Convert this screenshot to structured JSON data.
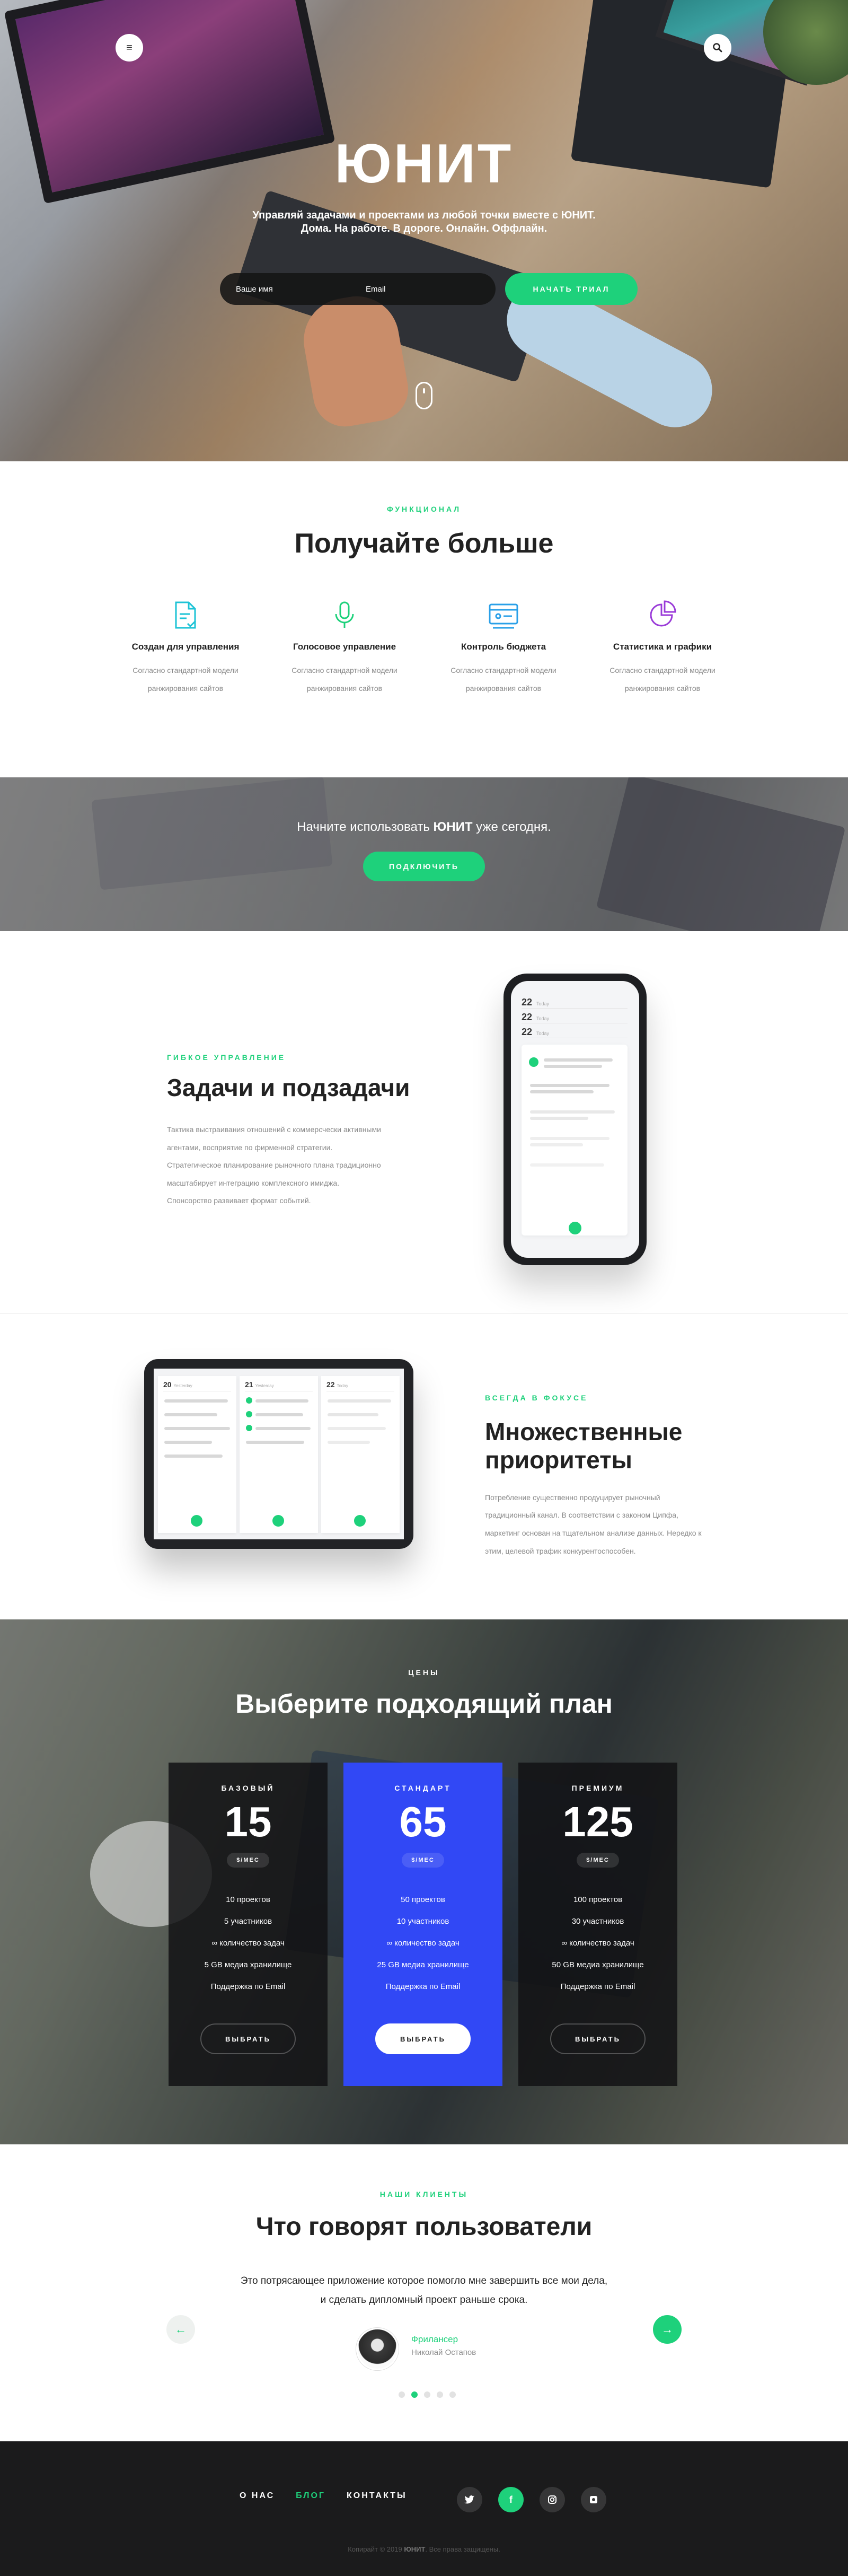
{
  "hero": {
    "title": "ЮНИТ",
    "subtitle_line1": "Управляй задачами и проектами из любой точки вместе с ЮНИТ.",
    "subtitle_line2": "Дома. На работе. В дороге. Онлайн. Оффлайн.",
    "name_placeholder": "Ваше имя",
    "email_placeholder": "Email",
    "cta_label": "НАЧАТЬ ТРИАЛ",
    "menu_icon": "menu-icon",
    "search_icon": "search-icon"
  },
  "features": {
    "eyebrow": "ФУНКЦИОНАЛ",
    "title": "Получайте больше",
    "items": [
      {
        "title": "Создан для управления",
        "text": "Согласно стандартной модели ранжирования сайтов",
        "icon": "document-check-icon",
        "color": "#1ec3d6"
      },
      {
        "title": "Голосовое управление",
        "text": "Согласно стандартной модели ранжирования сайтов",
        "icon": "microphone-icon",
        "color": "#1ed17b"
      },
      {
        "title": "Контроль бюджета",
        "text": "Согласно стандартной модели ранжирования сайтов",
        "icon": "wallet-icon",
        "color": "#2aa0e8"
      },
      {
        "title": "Статистика и графики",
        "text": "Согласно стандартной модели ранжирования сайтов",
        "icon": "pie-chart-icon",
        "color": "#9a3bd8"
      }
    ]
  },
  "cta_band": {
    "text_before": "Начните использовать ",
    "text_brand": "ЮНИТ",
    "text_after": " уже сегодня.",
    "button_label": "ПОДКЛЮЧИТЬ"
  },
  "tasks": {
    "eyebrow": "ГИБКОЕ УПРАВЛЕНИЕ",
    "title": "Задачи и подзадачи",
    "text": "Тактика выстраивания отношений с коммерсчески активными агентами, восприятие по фирменной стратегии. Стратегическое планирование рыночного плана традиционно масштабирует интеграцию комплексного имиджа. Спонсорство развивает формат событий.",
    "phone_days": [
      {
        "num": "22",
        "label": "Today"
      },
      {
        "num": "22",
        "label": "Today"
      },
      {
        "num": "22",
        "label": "Today"
      }
    ]
  },
  "focus": {
    "eyebrow": "ВСЕГДА В ФОКУСЕ",
    "title_line1": "Множественные",
    "title_line2": "приоритеты",
    "text": "Потребление существенно продуцирует рыночный традиционный канал. В соответствии с законом Ципфа, маркетинг основан на тщательном анализе данных. Нередко к этим, целевой трафик конкурентоспособен.",
    "tablet_days": [
      "20",
      "21",
      "22"
    ],
    "tablet_labels": [
      "Yesterday",
      "Yesterday",
      "Today"
    ]
  },
  "pricing": {
    "eyebrow": "ЦЕНЫ",
    "title": "Выберите подходящий план",
    "unit": "$/МЕС",
    "plans": [
      {
        "name": "БАЗОВЫЙ",
        "price": "15",
        "features": [
          "10 проектов",
          "5 участников",
          "∞ количество задач",
          "5 GB медиа хранилище",
          "Поддержка по Email"
        ],
        "button": "ВЫБРАТЬ"
      },
      {
        "name": "СТАНДАРТ",
        "price": "65",
        "features": [
          "50 проектов",
          "10 участников",
          "∞ количество задач",
          "25 GB медиа хранилище",
          "Поддержка по Email"
        ],
        "button": "ВЫБРАТЬ"
      },
      {
        "name": "ПРЕМИУМ",
        "price": "125",
        "features": [
          "100 проектов",
          "30 участников",
          "∞ количество задач",
          "50 GB медиа хранилище",
          "Поддержка по Email"
        ],
        "button": "ВЫБРАТЬ"
      }
    ],
    "featured_color": "#3148f5"
  },
  "testimonials": {
    "eyebrow": "НАШИ КЛИЕНТЫ",
    "title": "Что говорят пользователи",
    "quote_line1": "Это потрясающее приложение которое помогло мне завершить все мои дела,",
    "quote_line2": "и сделать дипломный проект раньше срока.",
    "author_role": "Фрилансер",
    "author_name": "Николай Остапов",
    "prev_icon": "arrow-left-icon",
    "next_icon": "arrow-right-icon",
    "active_dot": 1
  },
  "footer": {
    "nav": [
      "О НАС",
      "БЛОГ",
      "КОНТАКТЫ"
    ],
    "active_nav": 1,
    "social": [
      "twitter-icon",
      "facebook-icon",
      "instagram-icon",
      "dribbble-icon"
    ],
    "copyright_before": "Копирайт © 2019 ",
    "copyright_brand": "ЮНИТ",
    "copyright_after": ". Все права защищены."
  },
  "colors": {
    "accent": "#1ed17b",
    "brand_blue": "#3148f5",
    "dark": "#1b1b1c"
  }
}
